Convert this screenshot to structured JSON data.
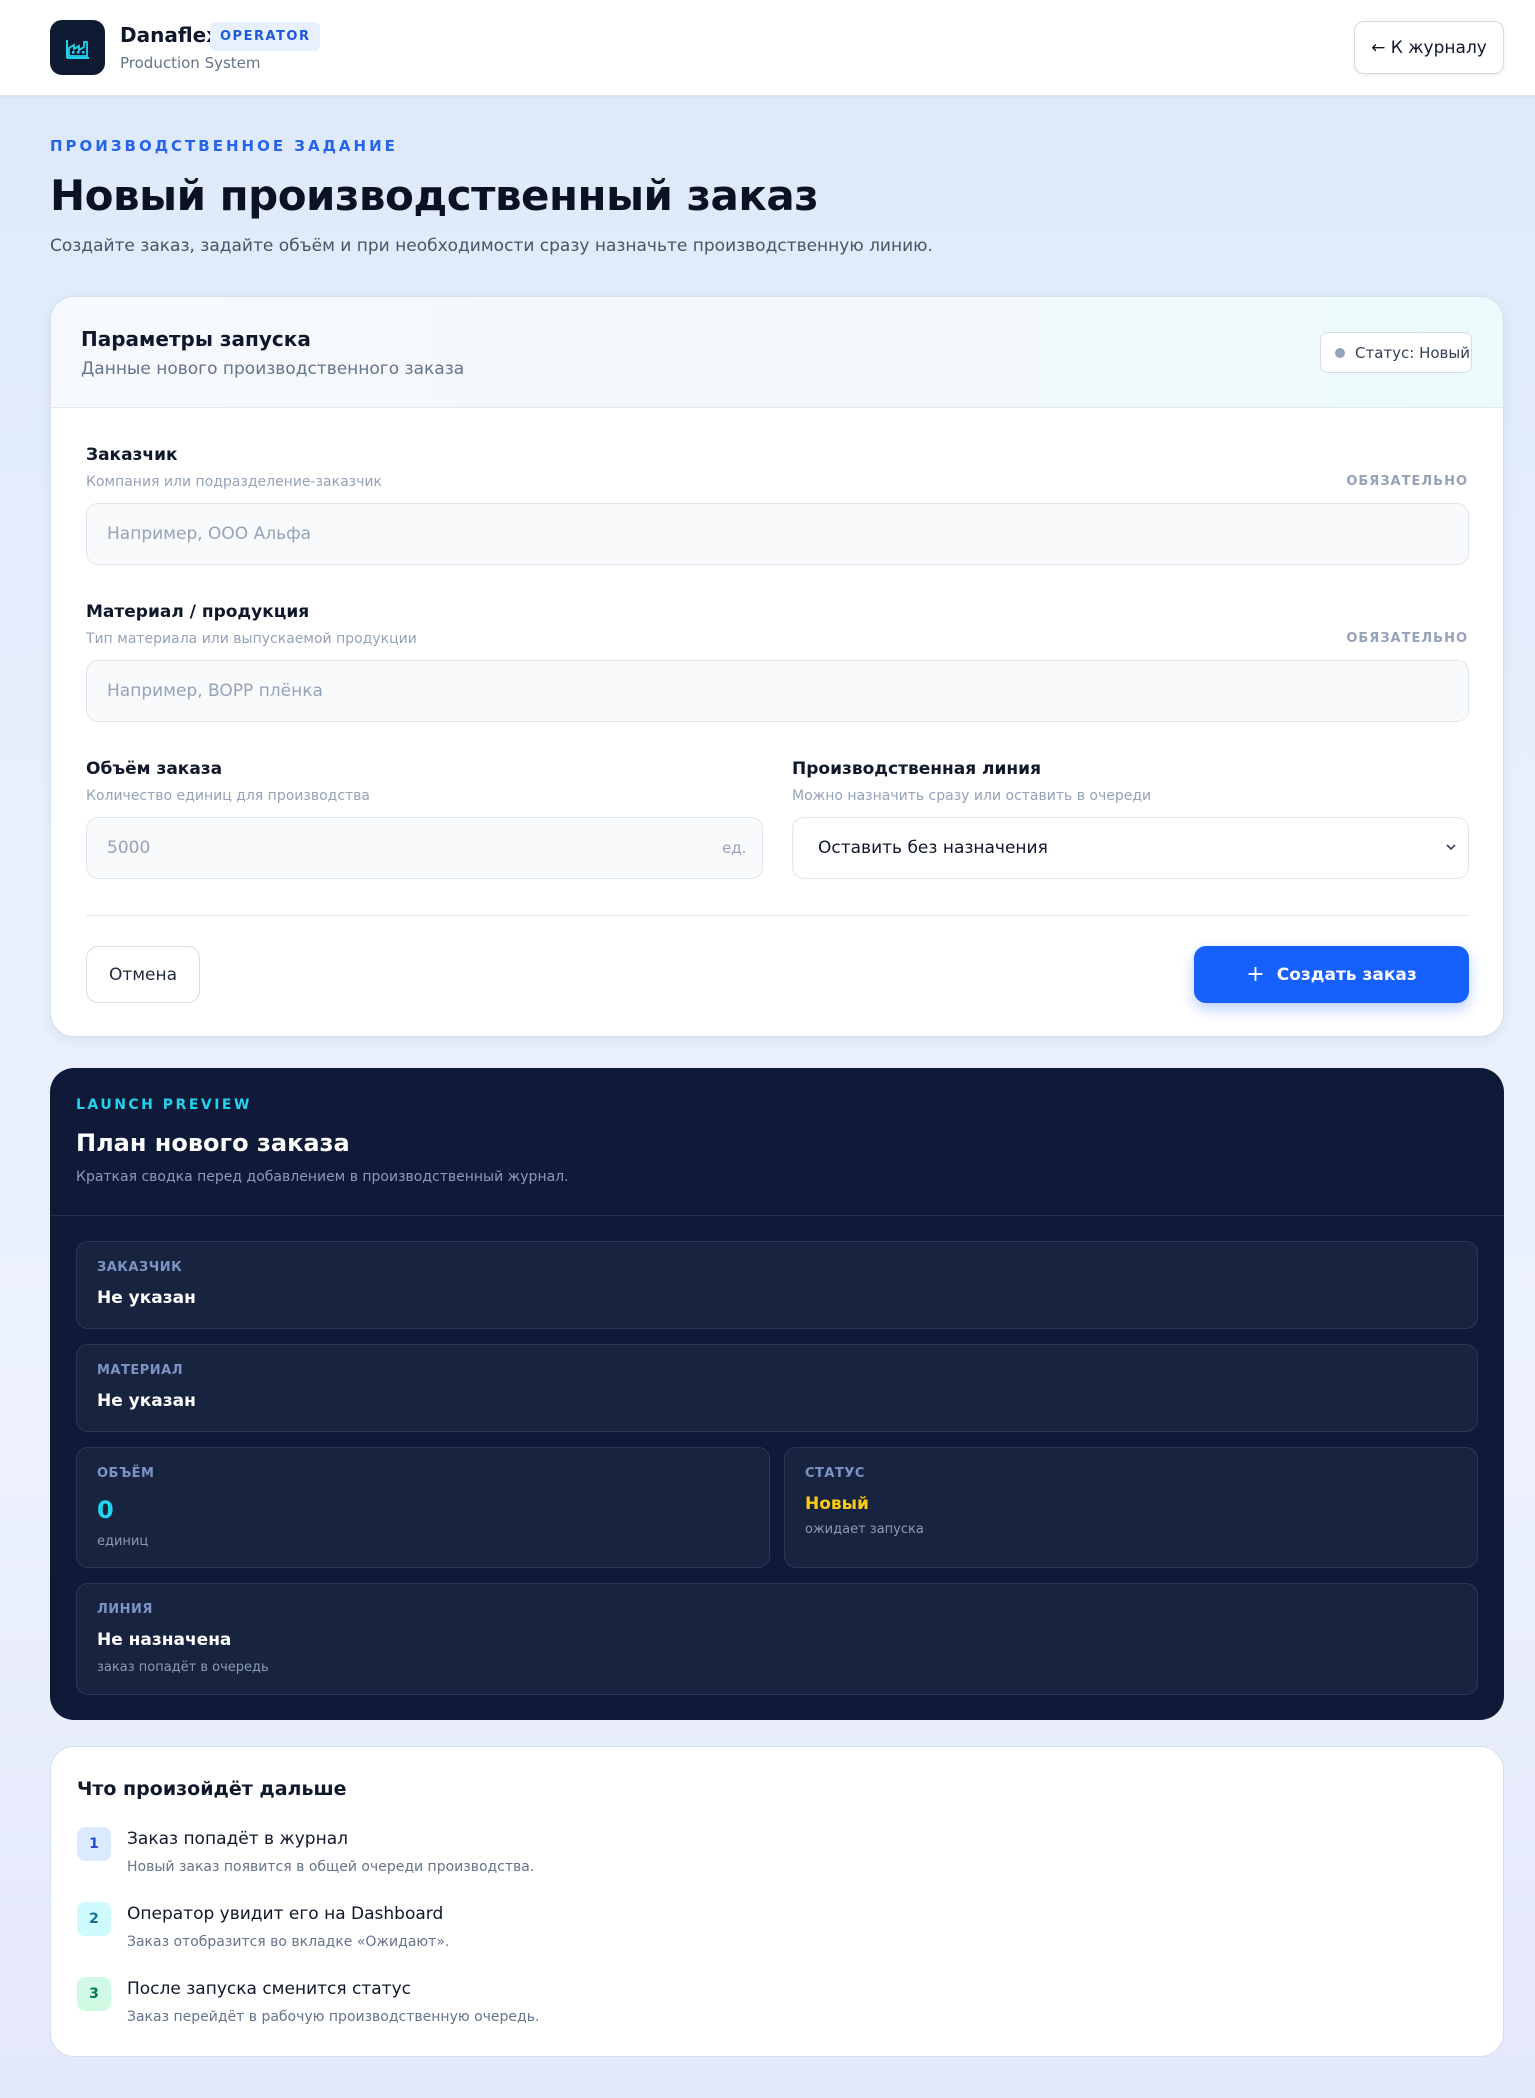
{
  "header": {
    "brand": "Danaflex",
    "badge": "OPERATOR",
    "subtitle": "Production System",
    "back_label": "← К журналу"
  },
  "page": {
    "kicker": "ПРОИЗВОДСТВЕННОЕ ЗАДАНИЕ",
    "title": "Новый производственный заказ",
    "description": "Создайте заказ, задайте объём и при необходимости сразу назначьте производственную линию."
  },
  "form": {
    "title": "Параметры запуска",
    "subtitle": "Данные нового производственного заказа",
    "status": "Статус: Новый",
    "customer": {
      "label": "Заказчик",
      "hint": "Компания или подразделение-заказчик",
      "required": "ОБЯЗАТЕЛЬНО",
      "placeholder": "Например, ООО Альфа",
      "value": ""
    },
    "material": {
      "label": "Материал / продукция",
      "hint": "Тип материала или выпускаемой продукции",
      "required": "ОБЯЗАТЕЛЬНО",
      "placeholder": "Например, BOPP плёнка",
      "value": ""
    },
    "volume": {
      "label": "Объём заказа",
      "hint": "Количество единиц для производства",
      "placeholder": "5000",
      "unit": "ед.",
      "value": ""
    },
    "line": {
      "label": "Производственная линия",
      "hint": "Можно назначить сразу или оставить в очереди",
      "selected": "Оставить без назначения"
    },
    "cancel_label": "Отмена",
    "submit_label": "Создать заказ"
  },
  "preview": {
    "kicker": "LAUNCH PREVIEW",
    "title": "План нового заказа",
    "subtitle": "Краткая сводка перед добавлением в производственный журнал.",
    "customer": {
      "label": "ЗАКАЗЧИК",
      "value": "Не указан"
    },
    "material": {
      "label": "МАТЕРИАЛ",
      "value": "Не указан"
    },
    "volume": {
      "label": "ОБЪЁМ",
      "value": "0",
      "note": "единиц"
    },
    "status": {
      "label": "СТАТУС",
      "value": "Новый",
      "note": "ожидает запуска"
    },
    "line": {
      "label": "ЛИНИЯ",
      "value": "Не назначена",
      "note": "заказ попадёт в очередь"
    }
  },
  "steps": {
    "title": "Что произойдёт дальше",
    "items": [
      {
        "num": "1",
        "title": "Заказ попадёт в журнал",
        "sub": "Новый заказ появится в общей очереди производства."
      },
      {
        "num": "2",
        "title": "Оператор увидит его на Dashboard",
        "sub": "Заказ отобразится во вкладке «Ожидают»."
      },
      {
        "num": "3",
        "title": "После запуска сменится статус",
        "sub": "Заказ перейдёт в рабочую производственную очередь."
      }
    ]
  },
  "colors": {
    "accent": "#1660fd",
    "cyan": "#22d3ee",
    "status_new": "#facc15",
    "preview_bg": "#0e1a37"
  }
}
